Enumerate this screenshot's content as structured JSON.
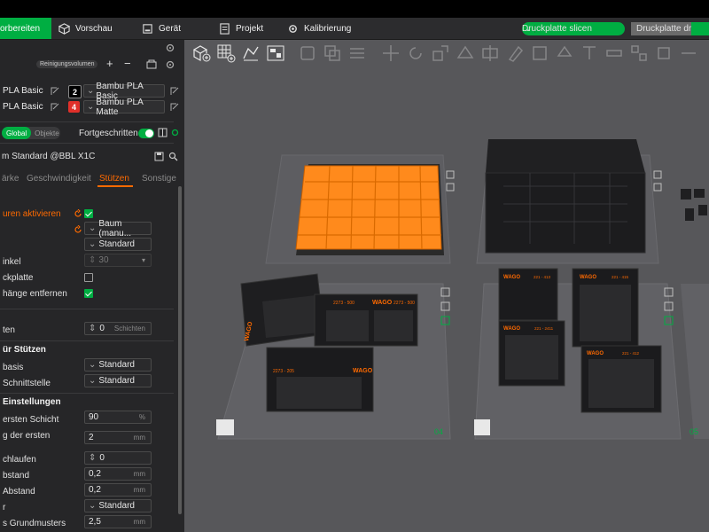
{
  "topbar": {
    "tabs": [
      {
        "label": "orbereiten",
        "active": true
      },
      {
        "label": "Vorschau"
      },
      {
        "label": "Gerät"
      },
      {
        "label": "Projekt"
      },
      {
        "label": "Kalibrierung"
      }
    ],
    "slice_label": "Druckplatte slicen",
    "print_label": "Druckplatte dr"
  },
  "panel": {
    "purge_label": "Reinigungsvolumen",
    "filaments": [
      {
        "left_name": "PLA Basic",
        "index": "2",
        "color": "#000000",
        "name": "Bambu PLA Basic"
      },
      {
        "left_name": "PLA Basic",
        "index": "4",
        "color": "#e0302a",
        "name": "Bambu PLA Matte"
      }
    ],
    "mode": {
      "global": "Global",
      "objects": "Objekte",
      "advanced": "Fortgeschritten"
    },
    "preset": "m Standard @BBL X1C",
    "tabs": [
      "ärke",
      "Geschwindigkeit",
      "Stützen",
      "Sonstige"
    ],
    "active_tab": "Stützen",
    "settings": {
      "enable_label": "uren aktivieren",
      "type_value": "Baum (manu...",
      "style_value": "Standard",
      "angle_label": "inkel",
      "angle_value": "30",
      "buildplate_label": "ckplatte",
      "remove_label": "hänge entfernen",
      "layers_label": "ten",
      "layers_value": "0",
      "layers_unit": "Schichten",
      "section_filament": "ür Stützen",
      "base_label": "basis",
      "base_value": "Standard",
      "interface_label": "Schnittstelle",
      "interface_value": "Standard",
      "section_advanced": "Einstellungen",
      "first_layer_label": "ersten Schicht",
      "first_layer_value": "90",
      "first_layer_unit": "%",
      "first_expand_label": "g der ersten",
      "first_expand_value": "2",
      "first_expand_unit": "mm",
      "loops_label": "chlaufen",
      "loops_value": "0",
      "top_dist_label": "bstand",
      "top_dist_value": "0,2",
      "top_dist_unit": "mm",
      "bottom_dist_label": "Abstand",
      "bottom_dist_value": "0,2",
      "bottom_dist_unit": "mm",
      "pattern_label": "r",
      "pattern_value": "Standard",
      "spacing_label": "s Grundmusters",
      "spacing_value": "2,5",
      "spacing_unit": "mm"
    }
  },
  "viewport": {
    "plate_numbers": [
      "04",
      "05"
    ],
    "brand_text": "WAGO",
    "box_labels": [
      "2273 - 500",
      "2273 - 205",
      "221 - 413",
      "221 - 415",
      "221 - 2411",
      "221 - 412"
    ],
    "colors": {
      "accent": "#00ae42",
      "highlight": "#ff8a1c",
      "bg": "#57575a"
    }
  }
}
